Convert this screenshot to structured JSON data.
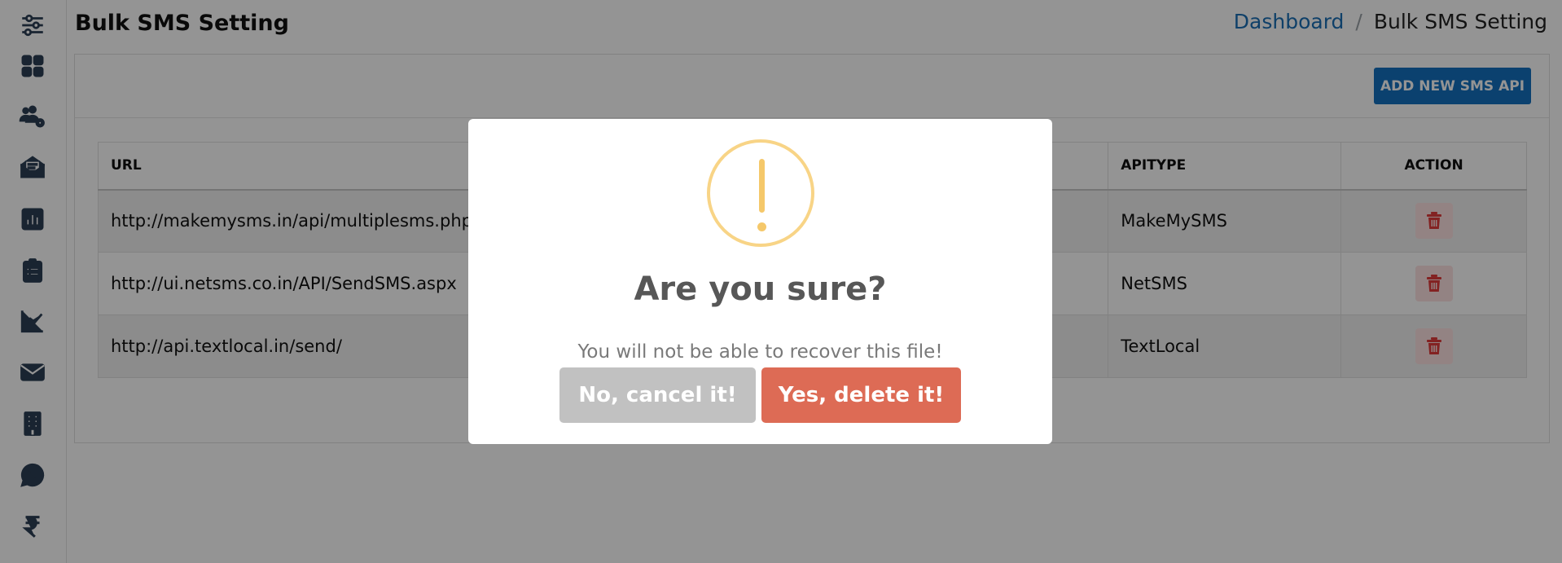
{
  "page": {
    "title": "Bulk SMS Setting"
  },
  "breadcrumb": {
    "home": "Dashboard",
    "separator": "/",
    "current": "Bulk SMS Setting"
  },
  "sidebar": {
    "items": [
      {
        "icon": "sliders-icon"
      },
      {
        "icon": "dashboard-grid-icon"
      },
      {
        "icon": "users-settings-icon"
      },
      {
        "icon": "mail-open-icon"
      },
      {
        "icon": "bar-chart-icon"
      },
      {
        "icon": "clipboard-icon"
      },
      {
        "icon": "line-chart-icon"
      },
      {
        "icon": "envelope-icon"
      },
      {
        "icon": "building-icon"
      },
      {
        "icon": "whatsapp-icon"
      },
      {
        "icon": "rupee-icon"
      }
    ]
  },
  "toolbar": {
    "add_label": "ADD NEW SMS API"
  },
  "table": {
    "headers": {
      "url": "URL",
      "apitype": "APITYPE",
      "action": "ACTION"
    },
    "rows": [
      {
        "url": "http://makemysms.in/api/multiplesms.php",
        "apitype": "MakeMySMS"
      },
      {
        "url": "http://ui.netsms.co.in/API/SendSMS.aspx",
        "apitype": "NetSMS"
      },
      {
        "url": "http://api.textlocal.in/send/",
        "apitype": "TextLocal"
      }
    ]
  },
  "dialog": {
    "title": "Are you sure?",
    "text": "You will not be able to recover this file!",
    "cancel_label": "No, cancel it!",
    "confirm_label": "Yes, delete it!"
  },
  "colors": {
    "primary": "#1470c0",
    "danger": "#e23b3b",
    "confirm": "#dd6b55",
    "cancel": "#c1c1c1",
    "warning": "#f8d486"
  }
}
